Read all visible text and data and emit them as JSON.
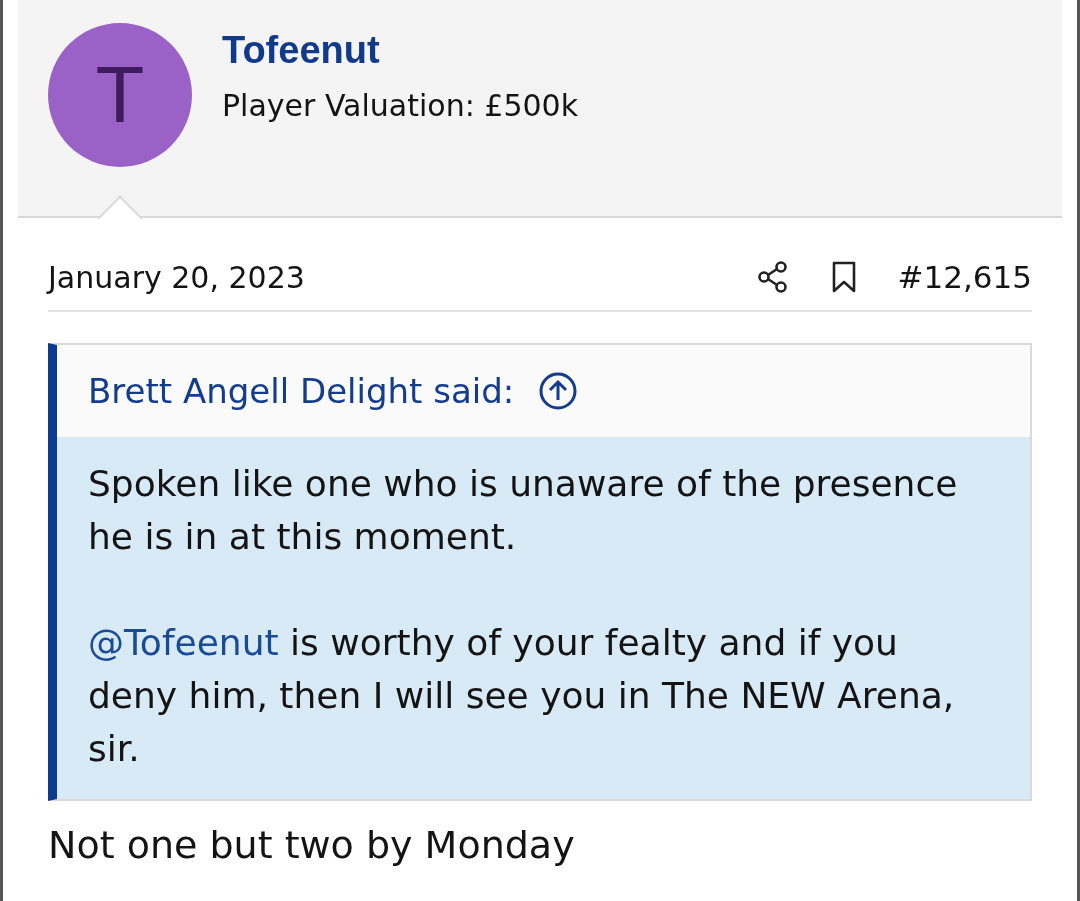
{
  "author": {
    "initial": "T",
    "name": "Tofeenut",
    "valuation": "Player Valuation: £500k"
  },
  "post": {
    "date": "January 20, 2023",
    "number": "#12,615"
  },
  "quote": {
    "author": "Brett Angell Delight said:",
    "paragraphs": [
      [
        {
          "kind": "text",
          "text": "Spoken like one who is unaware of the presence he is in at this moment."
        }
      ],
      [
        {
          "kind": "mention",
          "text": "@Tofeenut"
        },
        {
          "kind": "text",
          "text": " is worthy of your fealty and if you deny him, then I will see you in The NEW Arena, sir."
        }
      ]
    ]
  },
  "message": "Not one but two by Monday"
}
